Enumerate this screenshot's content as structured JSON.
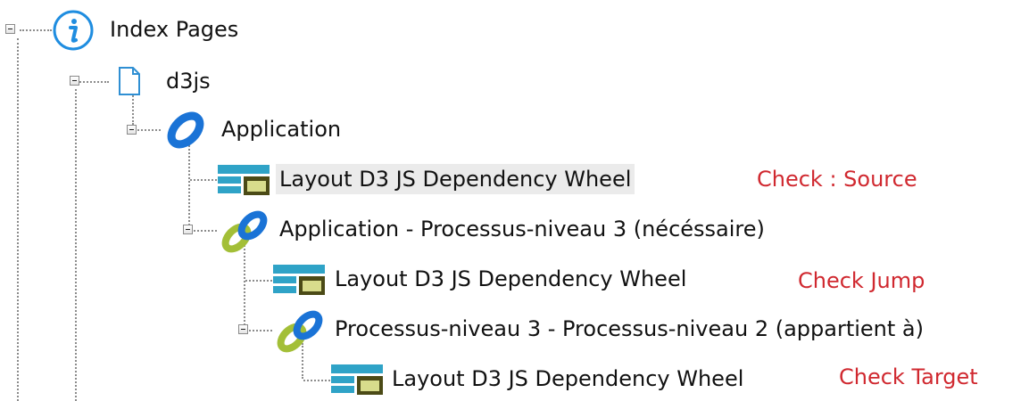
{
  "tree": {
    "root": {
      "label": "Index Pages",
      "icon": "info-icon"
    },
    "page": {
      "label": "d3js",
      "icon": "page-icon"
    },
    "application": {
      "label": "Application",
      "icon": "link-icon"
    },
    "layout_source": {
      "label": "Layout D3 JS Dependency Wheel",
      "icon": "layout-icon",
      "note": "Check : Source"
    },
    "relation_1": {
      "label": "Application - Processus-niveau 3 (nécéssaire)",
      "icon": "chain-link-icon"
    },
    "layout_jump": {
      "label": "Layout D3 JS Dependency Wheel",
      "icon": "layout-icon",
      "note": "Check Jump"
    },
    "relation_2": {
      "label": "Processus-niveau 3 - Processus-niveau 2 (appartient à)",
      "icon": "chain-link-icon"
    },
    "layout_target": {
      "label": "Layout D3 JS Dependency Wheel",
      "icon": "layout-icon",
      "note": "Check Target"
    }
  },
  "colors": {
    "note": "#d0282f",
    "info_icon": "#1f8de0",
    "link_blue": "#1a73d6",
    "link_green": "#a3bf37",
    "layout_teal": "#2fa3c7",
    "layout_olive": "#4b4a16",
    "layout_yellow": "#d8dc8c",
    "selection": "#ebebeb"
  }
}
